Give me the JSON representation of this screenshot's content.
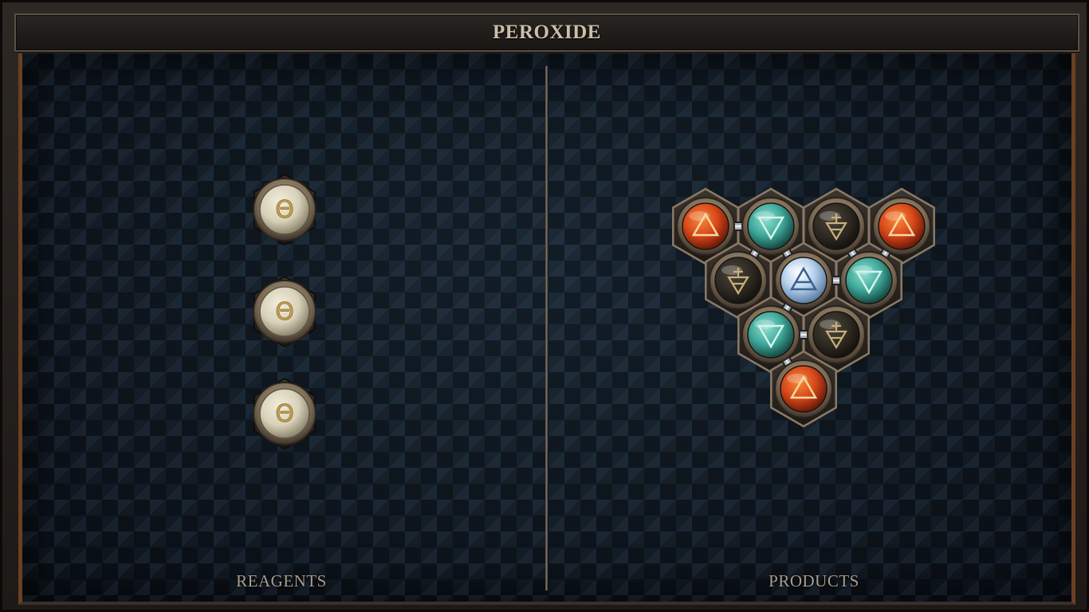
{
  "title": "PEROXIDE",
  "labels": {
    "reagents": "REAGENTS",
    "products": "PRODUCTS"
  },
  "reagents": [
    {
      "element": "salt",
      "symbol": "Θ"
    },
    {
      "element": "salt",
      "symbol": "Θ"
    },
    {
      "element": "salt",
      "symbol": "Θ"
    }
  ],
  "products": [
    {
      "id": "fire-1",
      "element": "fire",
      "symbol": "△",
      "col": 0,
      "row": 0
    },
    {
      "id": "water-1",
      "element": "water",
      "symbol": "▽",
      "col": 1,
      "row": 0
    },
    {
      "id": "earth-1",
      "element": "earth",
      "symbol": "🜃",
      "col": 2,
      "row": 0
    },
    {
      "id": "fire-2",
      "element": "fire",
      "symbol": "△",
      "col": 3,
      "row": 0
    },
    {
      "id": "earth-2",
      "element": "earth",
      "symbol": "🜃",
      "col": 0.5,
      "row": 1
    },
    {
      "id": "air-1",
      "element": "air",
      "symbol": "🜁",
      "col": 1.5,
      "row": 1
    },
    {
      "id": "water-2",
      "element": "water",
      "symbol": "▽",
      "col": 2.5,
      "row": 1
    },
    {
      "id": "water-3",
      "element": "water",
      "symbol": "▽",
      "col": 1,
      "row": 2
    },
    {
      "id": "earth-3",
      "element": "earth",
      "symbol": "🜃",
      "col": 2,
      "row": 2
    },
    {
      "id": "fire-3",
      "element": "fire",
      "symbol": "△",
      "col": 1.5,
      "row": 3
    }
  ],
  "bonds": [
    [
      "fire-1",
      "water-1"
    ],
    [
      "water-1",
      "air-1"
    ],
    [
      "water-1",
      "earth-2"
    ],
    [
      "air-1",
      "water-2"
    ],
    [
      "water-2",
      "fire-2"
    ],
    [
      "water-2",
      "earth-1"
    ],
    [
      "air-1",
      "water-3"
    ],
    [
      "water-3",
      "earth-3"
    ],
    [
      "water-3",
      "fire-3"
    ]
  ],
  "colors": {
    "fire": "#d8481a",
    "water": "#3fa89a",
    "earth": "#2e2a22",
    "air": "#b9d4ee",
    "salt": "#d9d3bd",
    "bezel": "#8a7a66",
    "accent": "#6b3f22"
  }
}
